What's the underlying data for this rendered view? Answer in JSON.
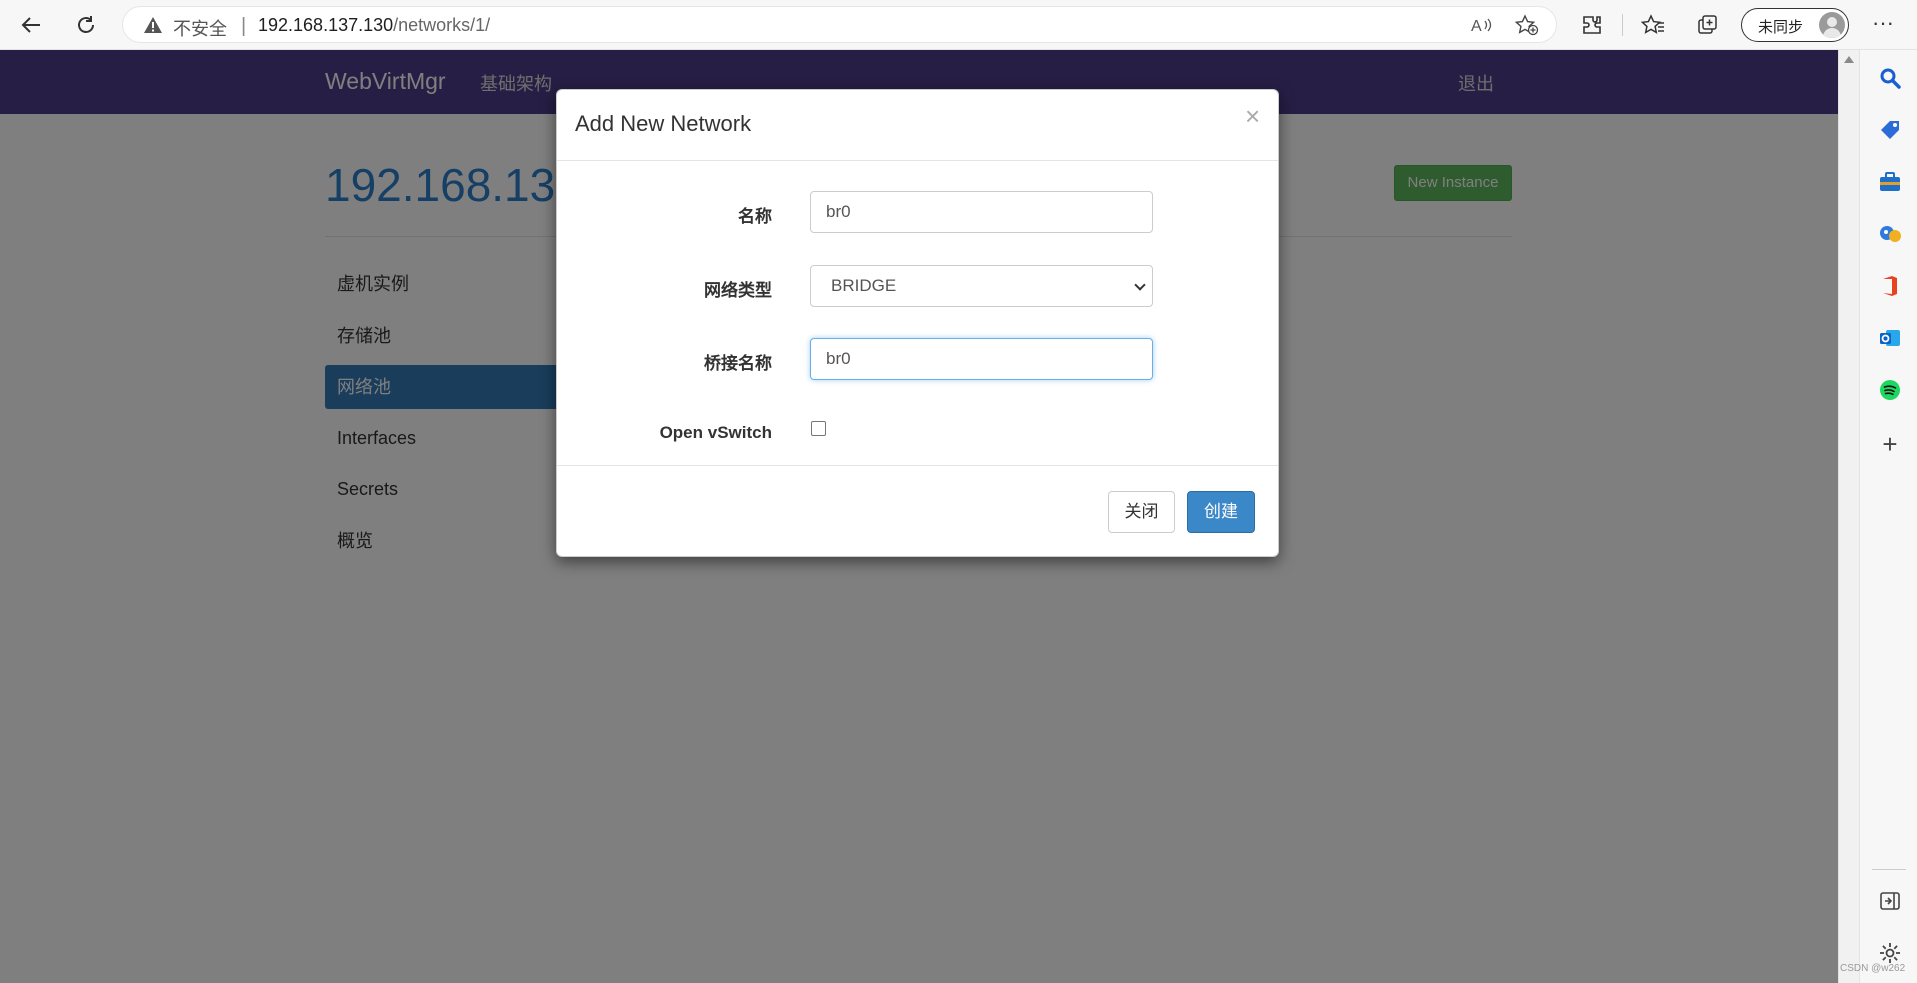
{
  "browser": {
    "insecure_label": "不安全",
    "separator": "|",
    "url_host": "192.168.137.130",
    "url_path": "/networks/1/",
    "sync_label": "未同步",
    "more_label": "···",
    "icons": [
      "back-icon",
      "refresh-icon",
      "warning-icon",
      "read-aloud-icon",
      "add-favorite-icon",
      "extensions-icon",
      "favorites-icon",
      "collections-icon",
      "profile-icon",
      "more-icon"
    ]
  },
  "sidebar_icons": [
    "search-icon",
    "shopping-tag-icon",
    "tools-icon",
    "games-icon",
    "office-icon",
    "outlook-icon",
    "spotify-icon",
    "add-icon",
    "split-screen-icon",
    "settings-icon"
  ],
  "watermark": "CSDN @w262",
  "app": {
    "brand": "WebVirtMgr",
    "nav_infrastructure": "基础架构",
    "nav_logout": "退出",
    "host_title": "192.168.137",
    "new_instance_label": "New Instance",
    "menu": [
      {
        "label": "虚机实例",
        "active": false
      },
      {
        "label": "存储池",
        "active": false
      },
      {
        "label": "网络池",
        "active": true
      },
      {
        "label": "Interfaces",
        "active": false
      },
      {
        "label": "Secrets",
        "active": false
      },
      {
        "label": "概览",
        "active": false
      }
    ]
  },
  "modal": {
    "title": "Add New Network",
    "close_symbol": "×",
    "name_label": "名称",
    "name_value": "br0",
    "type_label": "网络类型",
    "type_value": "BRIDGE",
    "bridge_label": "桥接名称",
    "bridge_value": "br0",
    "ovs_label": "Open vSwitch",
    "ovs_checked": false,
    "close_button": "关闭",
    "create_button": "创建"
  },
  "colors": {
    "navbar": "#4e3d8a",
    "primary": "#337ab7",
    "success": "#5cb85c"
  }
}
